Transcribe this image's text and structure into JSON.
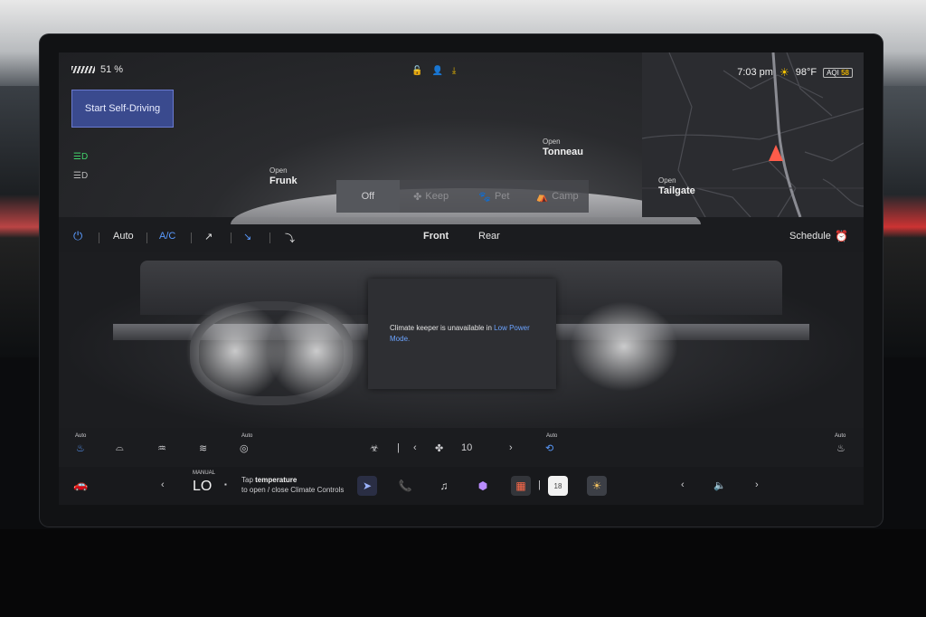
{
  "status": {
    "battery_percent": "51 %",
    "time": "7:03 pm",
    "temperature": "98°F",
    "aqi_label": "AQI",
    "aqi_value": "58"
  },
  "self_driving_button": "Start Self-Driving",
  "openings": {
    "frunk": {
      "small": "Open",
      "big": "Frunk"
    },
    "tonneau": {
      "small": "Open",
      "big": "Tonneau"
    },
    "tailgate": {
      "small": "Open",
      "big": "Tailgate"
    }
  },
  "keeper_modes": [
    {
      "label": "Off",
      "icon": "",
      "active": true
    },
    {
      "label": "Keep",
      "icon": "fan-icon",
      "active": false
    },
    {
      "label": "Pet",
      "icon": "paw-icon",
      "active": false
    },
    {
      "label": "Camp",
      "icon": "tent-icon",
      "active": false
    }
  ],
  "climate": {
    "auto_label": "Auto",
    "ac_label": "A/C",
    "front_label": "Front",
    "rear_label": "Rear",
    "schedule_label": "Schedule"
  },
  "popup": {
    "message": "Climate keeper is unavailable in ",
    "link": "Low Power Mode."
  },
  "bottom": {
    "auto_left": "Auto",
    "auto_mid": "Auto",
    "auto_recirc": "Auto",
    "auto_right": "Auto",
    "fan_speed": "10"
  },
  "taskbar": {
    "manual_label": "MANUAL",
    "temp_value": "LO",
    "tap_prefix": "Tap ",
    "tap_bold": "temperature",
    "tap_line2": "to open / close Climate Controls",
    "calendar_day": "18"
  },
  "colors": {
    "accent_blue": "#5a9bff",
    "self_drive_bg": "#3a4a8e",
    "headlight_green": "#41d36b",
    "sun_yellow": "#f5c400"
  }
}
